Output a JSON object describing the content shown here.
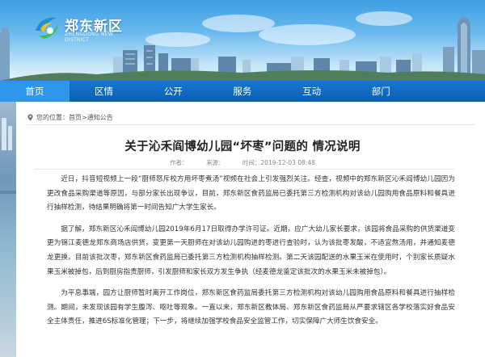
{
  "header": {
    "logo_cn": "郑东新区",
    "logo_en": "ZHENGDONG NEW DISTRICT"
  },
  "nav": {
    "items": [
      {
        "label": "首页",
        "active": true
      },
      {
        "label": "区情",
        "active": false
      },
      {
        "label": "公开",
        "active": false
      },
      {
        "label": "服务",
        "active": false
      },
      {
        "label": "互动",
        "active": false
      },
      {
        "label": "部门",
        "active": false
      }
    ]
  },
  "breadcrumb": {
    "current_position_label": "您的位置：",
    "home": "首页",
    "separator": ">",
    "section": "通知公告"
  },
  "article": {
    "title": "关于沁禾阎博幼儿园“坏枣”问题的 情况说明",
    "author": "作者：",
    "source": "来源：",
    "date": "时间：2019-12-03 08:48",
    "paragraphs": [
      "近日，抖音短视频上一段“厨师怒斥校方用坏枣煮汤”视频在社会上引发强烈关注。经查，视频中的郑东新区沁禾阎博幼儿园因为更改食品采购渠道等原因，与部分家长出现争议，目前，郑东新区食药监局已委托第三方检测机构对该幼儿园购用食品原料和餐具进行抽样检测，待结果明确将第一时间告知广大学生家长。",
      "据了解，郑东新区沁禾阎博幼儿园2019年6月17日取得办学许可证。近期，应广大幼儿家长要求，该园将食品采购的供货渠道变更为锦江麦德龙郑东商场店供货，变更第一天厨师在对该幼儿园购进的枣进行查验时，认为该批枣发酸，不适宜熬汤用，并通知麦德龙更换。目前该批次枣，郑东新区食药监局已委托第三方检测机构抽样检测。第二天该园配送的水果玉米在使用时，个别家长质疑水果玉米被掉包，后到厨房指责厨师，引发厨师和家长双方发生争执（经麦德龙鉴定该批次的水果玉米未被掉包）。",
      "为平息事端，园方让厨师暂时离开工作岗位，郑东新区食药监局委托第三方检测机构对该幼儿园购用食品原料和餐具进行抽样检测。期间，未发现该园有学生腹泻、呕吐等现象。一直以来，郑东新区教体局、郑东新区食药监局从严要求辖区各学校落实好食品安全主体责任，推进6S标准化管理；下一步，将继续加强学校食品安全监管工作，切实保障广大师生饮食安全。"
    ]
  },
  "colors": {
    "nav_bg": "#0b5fb2",
    "nav_active": "#2f97ea",
    "sky": "#6ab9ef"
  }
}
